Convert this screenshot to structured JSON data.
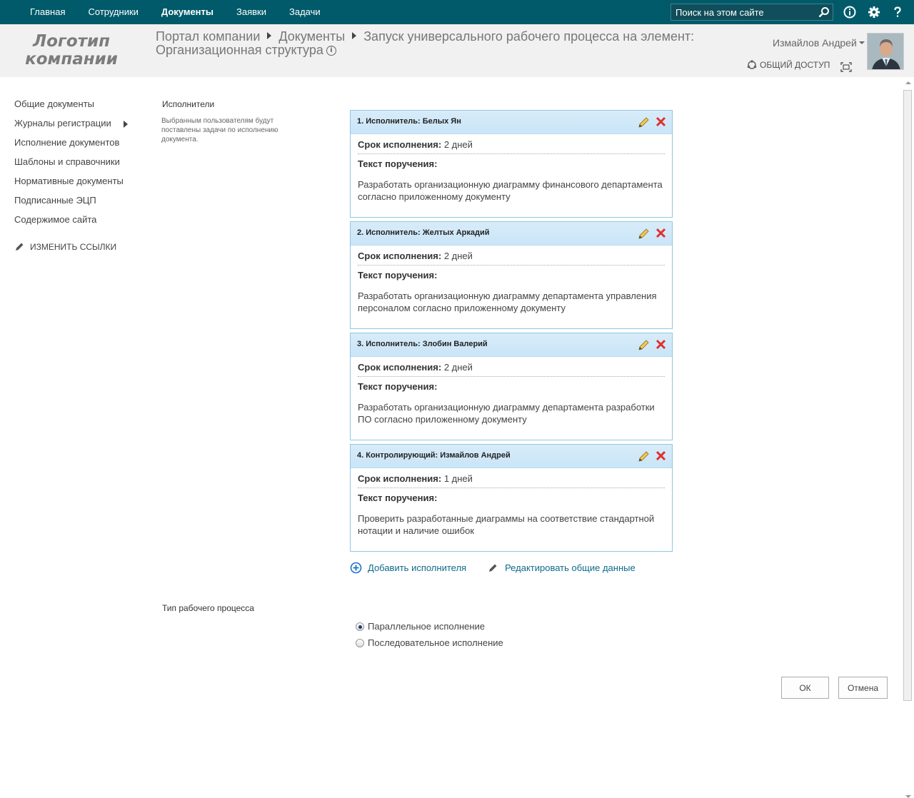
{
  "topnav": {
    "items": [
      {
        "label": "Главная",
        "active": false
      },
      {
        "label": "Сотрудники",
        "active": false
      },
      {
        "label": "Документы",
        "active": true
      },
      {
        "label": "Заявки",
        "active": false
      },
      {
        "label": "Задачи",
        "active": false
      }
    ],
    "search_placeholder": "Поиск на этом сайте",
    "icons": [
      "search-icon",
      "info-icon",
      "gear-icon",
      "help-icon"
    ]
  },
  "header": {
    "logo_line1": "Логотип",
    "logo_line2": "компании",
    "breadcrumb": [
      "Портал компании",
      "Документы",
      "Запуск универсального рабочего процесса на элемент:"
    ],
    "breadcrumb_tail": "Организационная структура",
    "user_name": "Измайлов Андрей",
    "share_label": "ОБЩИЙ ДОСТУП"
  },
  "sidebar": {
    "items": [
      {
        "label": "Общие документы"
      },
      {
        "label": "Журналы регистрации"
      },
      {
        "label": "Исполнение документов"
      },
      {
        "label": "Шаблоны и справочники"
      },
      {
        "label": "Нормативные документы"
      },
      {
        "label": "Подписанные ЭЦП"
      },
      {
        "label": "Содержимое сайта"
      }
    ],
    "edit_links": "ИЗМЕНИТЬ ССЫЛКИ"
  },
  "performers_section": {
    "title": "Исполнители",
    "description": "Выбранным пользователям будут поставлены задачи по исполнению документа."
  },
  "cards": [
    {
      "title": "1.   Исполнитель: Белых Ян",
      "deadline_label": "Срок исполнения:",
      "deadline": "2 дней",
      "text_label": "Текст поручения:",
      "text": "Разработать организационную диаграмму финансового департамента согласно приложенному документу"
    },
    {
      "title": "2.   Исполнитель: Желтых Аркадий",
      "deadline_label": "Срок исполнения:",
      "deadline": "2 дней",
      "text_label": "Текст поручения:",
      "text": "Разработать организационную диаграмму департамента управления персоналом согласно приложенному документу"
    },
    {
      "title": "3.   Исполнитель: Злобин Валерий",
      "deadline_label": "Срок исполнения:",
      "deadline": "2 дней",
      "text_label": "Текст поручения:",
      "text": "Разработать организационную диаграмму департамента разработки ПО согласно приложенному документу"
    },
    {
      "title": "4.   Контролирующий: Измайлов Андрей",
      "deadline_label": "Срок исполнения:",
      "deadline": "1 дней",
      "text_label": "Текст поручения:",
      "text": "Проверить разработанные диаграммы на соответствие стандартной нотации и наличие ошибок"
    }
  ],
  "actions": {
    "add_performer": "Добавить исполнителя",
    "edit_common": "Редактировать общие данные"
  },
  "workflow_type": {
    "title": "Тип рабочего процесса",
    "options": [
      {
        "label": "Параллельное исполнение",
        "selected": true
      },
      {
        "label": "Последовательное исполнение",
        "selected": false
      }
    ]
  },
  "buttons": {
    "ok": "ОК",
    "cancel": "Отмена"
  },
  "colors": {
    "topbar": "#005a6a",
    "card_border": "#93c6e3",
    "card_header": "#d8ecf9",
    "link": "#0f6a8a"
  }
}
